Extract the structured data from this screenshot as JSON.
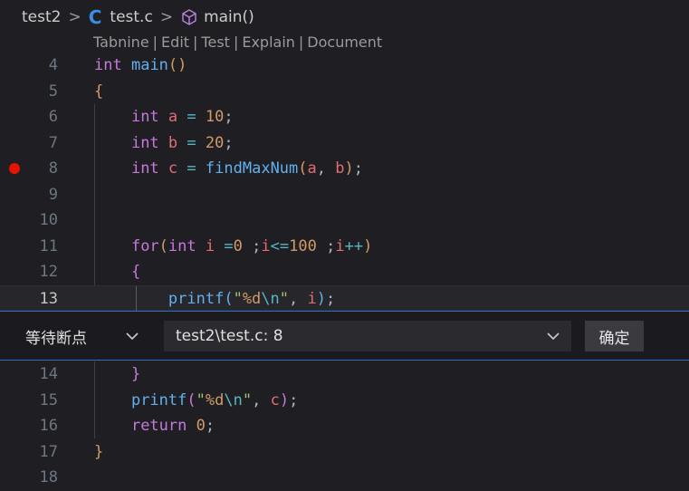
{
  "breadcrumb": {
    "items": [
      "test2",
      "test.c",
      "main()"
    ],
    "separator": ">"
  },
  "codelens": {
    "items": [
      "Tabnine",
      "Edit",
      "Test",
      "Explain",
      "Document"
    ],
    "separator": "|"
  },
  "editor": {
    "active_line": "13",
    "breakpoint_line": "8",
    "lines_top": [
      {
        "num": "4"
      },
      {
        "num": "5"
      },
      {
        "num": "6"
      },
      {
        "num": "7"
      },
      {
        "num": "8"
      },
      {
        "num": "9"
      },
      {
        "num": "10"
      },
      {
        "num": "11"
      },
      {
        "num": "12"
      },
      {
        "num": "13"
      }
    ],
    "lines_bottom": [
      {
        "num": "14"
      },
      {
        "num": "15"
      },
      {
        "num": "16"
      },
      {
        "num": "17"
      },
      {
        "num": "18"
      }
    ],
    "code": {
      "l4": [
        "int",
        "main",
        "(",
        ")"
      ],
      "l5": [
        "{"
      ],
      "l6": [
        "int",
        "a",
        "=",
        "10",
        ";"
      ],
      "l7": [
        "int",
        "b",
        "=",
        "20",
        ";"
      ],
      "l8": [
        "int",
        "c",
        "=",
        "findMaxNum",
        "(",
        "a",
        ", ",
        "b",
        ")",
        ";"
      ],
      "l11": [
        "for",
        "(",
        "int",
        "i",
        "=",
        "0",
        ";",
        "i",
        "<=",
        "100",
        ";",
        "i",
        "++",
        ")"
      ],
      "l12": [
        "{"
      ],
      "l13": [
        "printf",
        "(",
        "\"",
        "%d",
        "\\n",
        "\"",
        ", ",
        "i",
        ")",
        ";"
      ],
      "l14": [
        "}"
      ],
      "l15": [
        "printf",
        "(",
        "\"",
        "%d",
        "\\n",
        "\"",
        ", ",
        "c",
        ")",
        ";"
      ],
      "l16": [
        "return",
        "0",
        ";"
      ],
      "l17": [
        "}"
      ]
    }
  },
  "peek": {
    "condition_select": "等待断点",
    "location_select": "test2\\test.c: 8",
    "confirm_label": "确定"
  },
  "icons": {
    "c_file": "c-language-icon",
    "method": "cube-method-icon",
    "breakpoint": "breakpoint-icon",
    "chevron": "chevron-down-icon"
  },
  "colors": {
    "background": "#1f1f23",
    "breakpoint": "#e51400",
    "accent_border": "#2a6fc7",
    "c_icon": "#3a8ee6"
  }
}
